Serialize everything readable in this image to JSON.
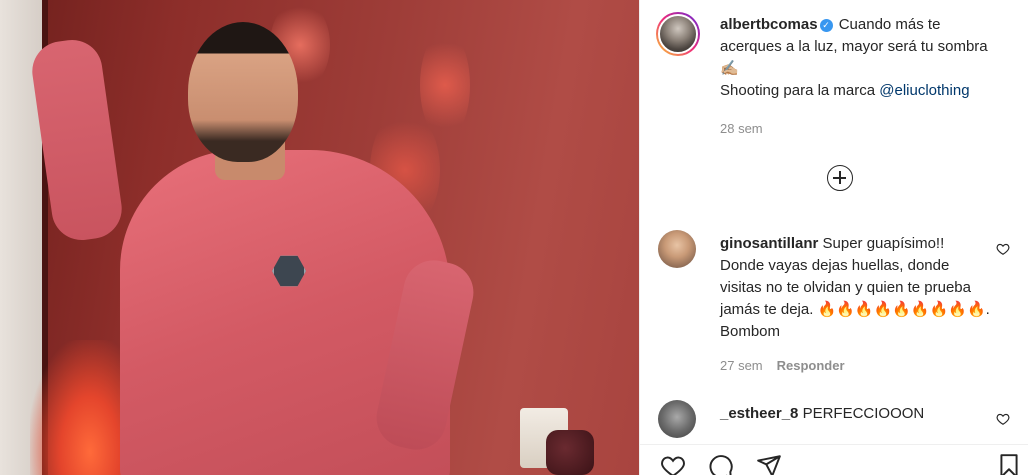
{
  "post": {
    "image_alt": "Man in red sweater leaning against a doorway"
  },
  "caption": {
    "username": "albertbcomas",
    "verified_badge": "✓",
    "text": "Cuando más te acerques a la luz, mayor será tu sombra ✍🏼",
    "text2_prefix": "Shooting para la marca ",
    "mention": "@eliuclothing",
    "time": "28 sem"
  },
  "comments": [
    {
      "username": "ginosantillanr",
      "text": "Super guapísimo!! Donde vayas dejas huellas, donde visitas no te olvidan y quien te prueba jamás te deja. 🔥🔥🔥🔥🔥🔥🔥🔥🔥. Bombom",
      "time": "27 sem",
      "reply_label": "Responder"
    },
    {
      "username": "_estheer_8",
      "text": "PERFECCIOOON"
    }
  ],
  "icons": {
    "load_more": "plus-circle-icon",
    "like": "heart-icon",
    "comment": "comment-icon",
    "share": "paper-plane-icon",
    "save": "bookmark-icon"
  },
  "colors": {
    "text": "#262626",
    "muted": "#8e8e8e",
    "link": "#00376b",
    "verified": "#3897f0"
  }
}
